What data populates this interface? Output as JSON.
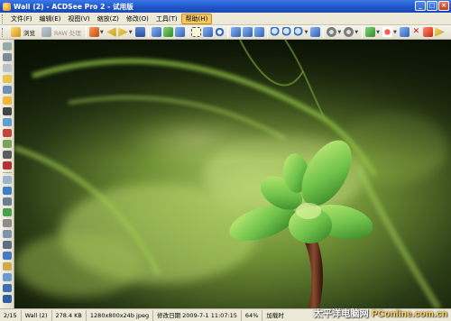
{
  "window": {
    "title": "Wall (2) - ACDSee Pro 2 - 试用版",
    "buttons": [
      "minimize",
      "maximize",
      "close"
    ]
  },
  "menu": {
    "items": [
      "文件(F)",
      "编辑(E)",
      "视图(V)",
      "缩放(Z)",
      "修改(O)",
      "工具(T)",
      "帮助(H)"
    ],
    "active_index": 6
  },
  "toolbar": {
    "browse_label": "浏览",
    "raw_label": "RAW 处理"
  },
  "status": {
    "index": "2/15",
    "filename": "Wall (2)",
    "filesize": "278.4 KB",
    "dimensions": "1280x800x24b jpeg",
    "modified_label": "修改日期",
    "modified_value": "2009-7-1 11:07:15",
    "zoom": "64%",
    "loading": "加载时"
  },
  "watermark": {
    "cn": "太平洋电脑网",
    "brand": "PConline.com.cn"
  },
  "colors": {
    "title_bar": "#2a62d6",
    "menu_bg": "#ece9d8",
    "active_menu": "#f6c864",
    "image_dark": "#0f1a08",
    "succulent_green": "#6fc24a"
  }
}
